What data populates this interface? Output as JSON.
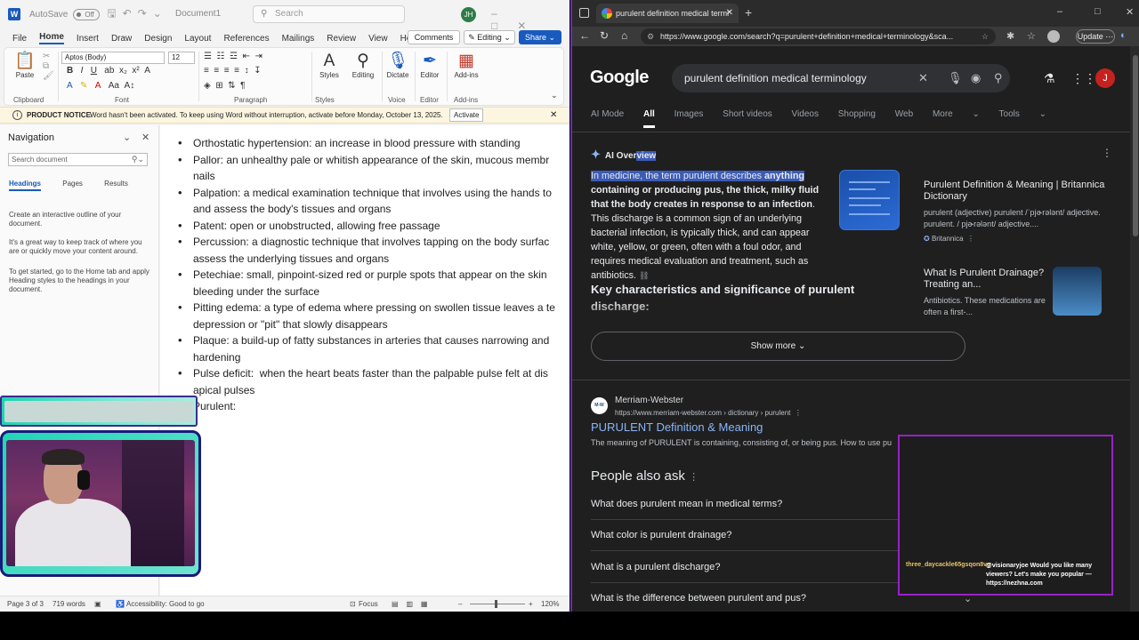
{
  "word": {
    "autosave_label": "AutoSave",
    "autosave_state": "Off",
    "doc_name": "Document1",
    "search_placeholder": "Search",
    "user_initials": "JH",
    "menu": [
      "File",
      "Home",
      "Insert",
      "Draw",
      "Design",
      "Layout",
      "References",
      "Mailings",
      "Review",
      "View",
      "Help"
    ],
    "comments_label": "Comments",
    "editing_label": "Editing",
    "share_label": "Share",
    "ribbon": {
      "paste": "Paste",
      "font_name": "Aptos (Body)",
      "font_size": "12",
      "styles": "Styles",
      "editing": "Editing",
      "dictate": "Dictate",
      "editor": "Editor",
      "addins": "Add-ins",
      "groups": [
        "Clipboard",
        "Font",
        "Paragraph",
        "Styles",
        "Voice",
        "Editor",
        "Add-ins"
      ]
    },
    "notice": {
      "title": "PRODUCT NOTICE",
      "message": "Word hasn't been activated. To keep using Word without interruption, activate before Monday, October 13, 2025.",
      "button": "Activate"
    },
    "navigation": {
      "title": "Navigation",
      "search_placeholder": "Search document",
      "tabs": [
        "Headings",
        "Pages",
        "Results"
      ],
      "text1": "Create an interactive outline of your document.",
      "text2": "It's a great way to keep track of where you are or quickly move your content around.",
      "text3": "To get started, go to the Home tab and apply Heading styles to the headings in your document."
    },
    "bullets": [
      "Orthostatic hypertension: an increase in blood pressure with standing",
      "Pallor: an unhealthy pale or whitish appearance of the skin, mucous membr",
      "nails",
      "Palpation: a medical examination technique that involves using the hands to",
      "and assess the body's tissues and organs",
      "Patent: open or unobstructed, allowing free passage",
      "Percussion: a diagnostic technique that involves tapping on the body surfac",
      "assess the underlying tissues and organs",
      "Petechiae: small, pinpoint-sized red or purple spots that appear on the skin",
      "bleeding under the surface",
      "Pitting edema: a type of edema where pressing on swollen tissue leaves a te",
      "depression or \"pit\" that slowly disappears",
      "Plaque: a build-up of fatty substances in arteries that causes narrowing and",
      "hardening",
      "Pulse deficit:  when the heart beats faster than the palpable pulse felt at dis",
      "apical pulses",
      "Purulent:"
    ],
    "status": {
      "page": "Page 3 of 3",
      "words": "719 words",
      "accessibility": "Accessibility: Good to go",
      "focus": "Focus",
      "zoom": "120%",
      "zoom_level_fraction": 0.47
    }
  },
  "browser": {
    "tab_title": "purulent definition medical termi",
    "url": "https://www.google.com/search?q=purulent+definition+medical+terminology&sca...",
    "update_label": "Update",
    "google_logo": "Google",
    "query": "purulent definition medical terminology",
    "user_initial": "J",
    "tabs": [
      "AI Mode",
      "All",
      "Images",
      "Short videos",
      "Videos",
      "Shopping",
      "Web",
      "More",
      "Tools"
    ],
    "ai_overview": {
      "title_plain": "AI Over",
      "title_highlight": "view",
      "text_highlight": "In medicine, the term purulent describes ",
      "text_bold_highlight": "anything",
      "text_bold": " containing or producing pus, the thick, milky fluid that the body creates in response to an infection",
      "text_rest": ". This discharge is a common sign of an underlying bacterial infection, is typically thick, and can appear white, yellow, or green, often with a foul odor, and requires medical evaluation and treatment, such as antibiotics.",
      "key_heading": "Key characteristics and significance of purulent discharge:",
      "show_more": "Show more"
    },
    "sources": [
      {
        "title": "Purulent Definition & Meaning | Britannica Dictionary",
        "snippet": "purulent (adjective) purulent /ˈpjɚrələnt/ adjective. purulent. / pjɚrələnt/ adjective....",
        "site": "Britannica"
      },
      {
        "title": "What Is Purulent Drainage? Treating an...",
        "snippet": "Antibiotics. These medications are often a first-..."
      }
    ],
    "result": {
      "site_name": "Merriam-Webster",
      "site_url": "https://www.merriam-webster.com › dictionary › purulent",
      "icon_text": "M-W",
      "title": "PURULENT Definition & Meaning",
      "snippet": "The meaning of PURULENT is containing, consisting of, or being pus. How to use pu"
    },
    "people_also_ask": {
      "title": "People also ask",
      "questions": [
        "What does purulent mean in medical terms?",
        "What color is purulent drainage?",
        "What is a purulent discharge?",
        "What is the difference between purulent and pus?"
      ]
    }
  },
  "chat": {
    "username": "three_daycackle65gsqon8vg",
    "message": "@visionaryjoe Would you like many viewers? Let's make you popular — https://nezhna.com"
  },
  "colors": {
    "word_blue": "#185abd",
    "browser_border": "#6b2fb3",
    "google_link": "#8ab4f8",
    "chat_border": "#9a20c9",
    "overlay_teal": "#1dd3b0"
  }
}
